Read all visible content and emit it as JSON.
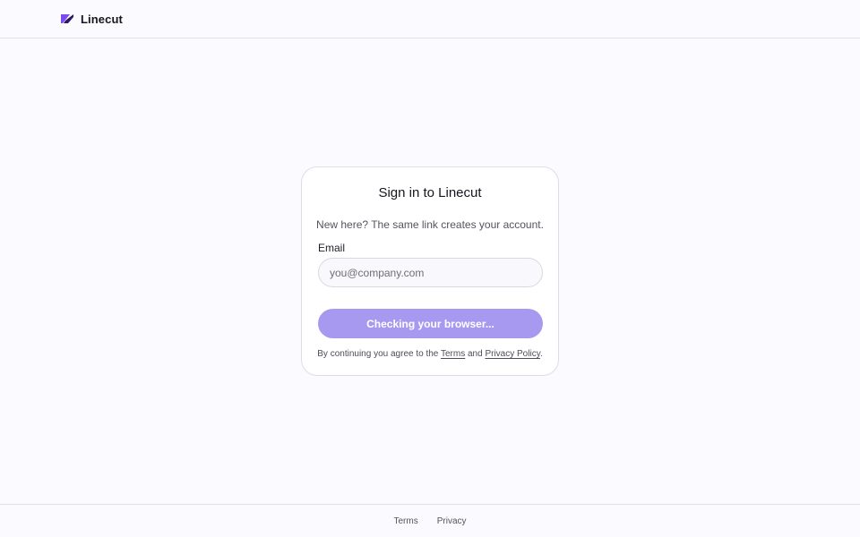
{
  "header": {
    "brand_name": "Linecut",
    "brand_icon": "linecut-logo-icon",
    "brand_color": "#6d3fe6"
  },
  "signin": {
    "title": "Sign in to Linecut",
    "subtitle": "New here? The same link creates your account.",
    "email_label": "Email",
    "email_placeholder": "you@company.com",
    "email_value": "",
    "submit_label": "Checking your browser...",
    "submit_color": "#a899f0",
    "legal_prefix": "By continuing you agree to the ",
    "legal_terms": "Terms",
    "legal_and": " and ",
    "legal_privacy": "Privacy Policy",
    "legal_suffix": "."
  },
  "footer": {
    "terms": "Terms",
    "privacy": "Privacy"
  }
}
